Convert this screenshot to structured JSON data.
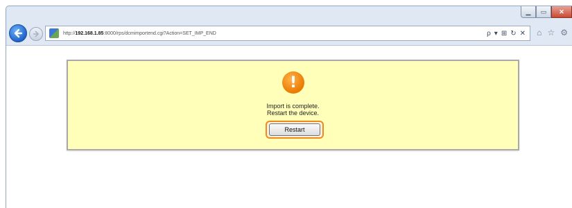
{
  "browser": {
    "address": {
      "protocol": "http://",
      "host": "192.168.1.85",
      "path": ":8000/rps/dcmimportend.cgi?Action=SET_IMP_END"
    },
    "address_tools": {
      "search": "ρ",
      "dropdown": "▾",
      "compat": "⊞",
      "refresh": "↻",
      "stop": "✕"
    },
    "right_icons": {
      "home": "⌂",
      "favorites": "☆",
      "tools": "⚙"
    },
    "window_controls": {
      "minimize": "▁",
      "maximize": "▭",
      "close": "✕"
    }
  },
  "dialog": {
    "icon": "!",
    "message_line1": "Import is complete.",
    "message_line2": "Restart the device.",
    "restart_label": "Restart"
  },
  "colors": {
    "panel_bg": "#ffffb9",
    "warning_icon": "#ea7a00",
    "focus_ring": "#f08a1c"
  }
}
